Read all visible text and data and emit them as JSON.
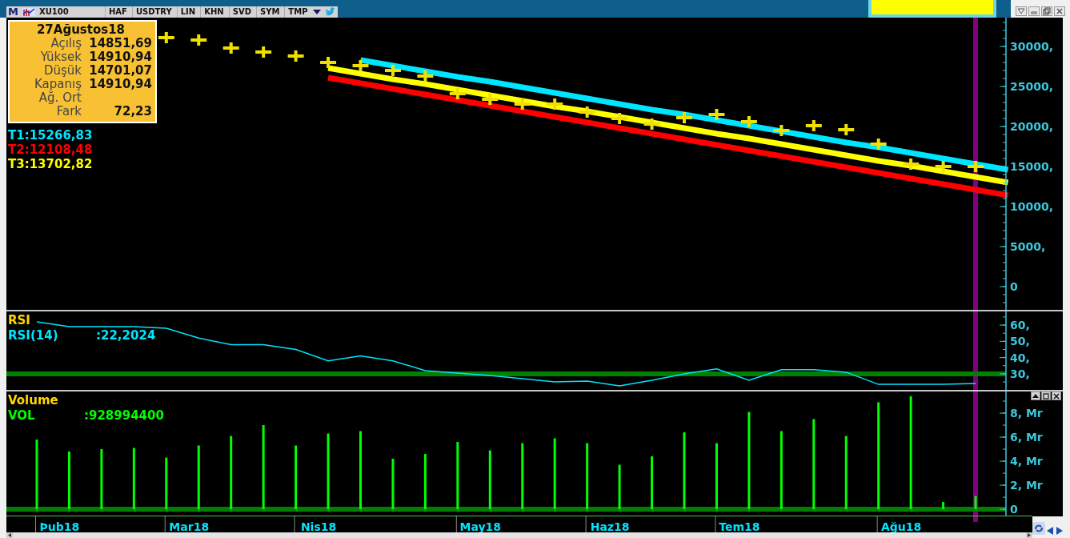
{
  "toolbar": {
    "logo": "M",
    "symbol": "XU100",
    "buttons": [
      "HAF",
      "USDTRY",
      "LIN",
      "KHN",
      "SVD",
      "SYM",
      "TMP"
    ]
  },
  "info_box": {
    "date": "27Ağustos18",
    "rows": [
      {
        "label": "Açılış",
        "value": "14851,69"
      },
      {
        "label": "Yüksek",
        "value": "14910,94"
      },
      {
        "label": "Düşük",
        "value": "14701,07"
      },
      {
        "label": "Kapanış",
        "value": "14910,94"
      },
      {
        "label": "Ağ. Ort"
      },
      {
        "label": "Fark",
        "value": "72,23"
      }
    ]
  },
  "price_panel": {
    "chart_data": {
      "type": "line",
      "ylim": [
        -2900,
        33600
      ],
      "yticks": [
        {
          "value": 30000,
          "label": "30000,"
        },
        {
          "value": 25000,
          "label": "25000,"
        },
        {
          "value": 20000,
          "label": "20000,"
        },
        {
          "value": 15000,
          "label": "15000,"
        },
        {
          "value": 10000,
          "label": "10000,"
        },
        {
          "value": 5000,
          "label": "5000,"
        },
        {
          "value": 0,
          "label": "0"
        }
      ],
      "series": [
        {
          "name": "T1:15266,83",
          "color": "#00e5ff",
          "values": [
            null,
            null,
            null,
            null,
            null,
            null,
            null,
            null,
            null,
            null,
            28300,
            27600,
            26900,
            26200,
            25600,
            24900,
            24200,
            23500,
            22800,
            22100,
            21500,
            20800,
            20100,
            19400,
            18700,
            18000,
            17400,
            16700,
            16000,
            15300,
            14600
          ]
        },
        {
          "name": "T2:12108,48",
          "color": "#ff0000",
          "values": [
            null,
            null,
            null,
            null,
            null,
            null,
            null,
            null,
            null,
            26100,
            25400,
            24700,
            24000,
            23300,
            22600,
            21900,
            21200,
            20500,
            19800,
            19100,
            18400,
            17700,
            17000,
            16300,
            15600,
            14900,
            14200,
            13500,
            12800,
            12100,
            11400
          ]
        },
        {
          "name": "T3:13702,82",
          "color": "#ffff00",
          "values": [
            null,
            null,
            null,
            null,
            null,
            null,
            null,
            null,
            null,
            27300,
            26600,
            25900,
            25300,
            24600,
            23900,
            23200,
            22500,
            21900,
            21200,
            20500,
            19800,
            19100,
            18500,
            17800,
            17100,
            16400,
            15700,
            15100,
            14400,
            13700,
            13000
          ]
        }
      ]
    }
  },
  "rsi_panel": {
    "title": "RSI",
    "reading": ":22,2024",
    "chart_data": {
      "type": "line",
      "ylim": [
        20.1,
        68.4
      ],
      "yticks": [
        {
          "value": 60,
          "label": "60,"
        },
        {
          "value": 50,
          "label": "50,"
        },
        {
          "value": 40,
          "label": "40,"
        },
        {
          "value": 30,
          "label": "30,"
        }
      ],
      "series": [
        {
          "name": "RSI(14)",
          "color": "#00e5ff",
          "values": [
            62,
            59,
            59,
            59,
            58,
            52,
            48,
            48,
            45,
            38,
            41,
            38,
            32,
            30.5,
            29,
            27,
            25,
            25.5,
            22.5,
            26,
            30,
            33,
            26,
            32.5,
            32.5,
            31,
            23.5,
            23.5,
            23.5,
            24,
            null
          ]
        }
      ],
      "ref_lines": [
        {
          "value": 30,
          "axis": "y"
        }
      ]
    }
  },
  "volume_panel": {
    "title": "Volume",
    "reading": ":928994400",
    "chart_data": {
      "type": "bar",
      "categories": [
        null,
        "Þub18",
        null,
        null,
        null,
        "Mar18",
        null,
        null,
        null,
        "Nis18",
        null,
        null,
        null,
        null,
        "May18",
        null,
        null,
        null,
        "Haz18",
        null,
        null,
        null,
        "Tem18",
        null,
        null,
        null,
        null,
        "Ağu18",
        null,
        null,
        null
      ],
      "ylim": [
        -0.53,
        9.8
      ],
      "yticks": [
        {
          "value": 8,
          "label": "8, Mr"
        },
        {
          "value": 6,
          "label": "6, Mr"
        },
        {
          "value": 4,
          "label": "4, Mr"
        },
        {
          "value": 2,
          "label": "2, Mr"
        },
        {
          "value": 0,
          "label": "0"
        }
      ],
      "series": [
        {
          "name": "VOL",
          "color": "#00ff00",
          "values": [
            5.8,
            4.8,
            5.0,
            5.1,
            4.3,
            5.3,
            6.1,
            7.0,
            5.3,
            6.3,
            6.5,
            4.2,
            4.6,
            5.6,
            4.9,
            5.5,
            5.9,
            5.5,
            3.7,
            4.4,
            6.4,
            5.5,
            8.1,
            6.5,
            7.5,
            6.1,
            8.9,
            9.4,
            0.6,
            1.1,
            null
          ]
        }
      ],
      "ref_lines": [
        {
          "value": 0,
          "axis": "y"
        }
      ]
    }
  }
}
